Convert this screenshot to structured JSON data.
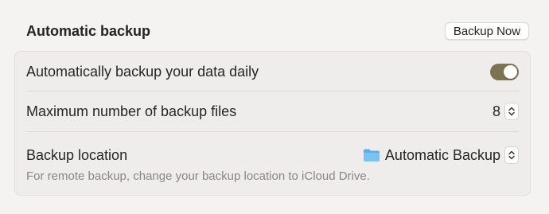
{
  "section": {
    "title": "Automatic backup",
    "backup_now_label": "Backup Now"
  },
  "settings": {
    "daily_backup": {
      "label": "Automatically backup your data daily",
      "enabled": true,
      "toggle_color": "#7e7255"
    },
    "max_files": {
      "label": "Maximum number of backup files",
      "value": "8"
    },
    "location": {
      "label": "Backup location",
      "value": "Automatic Backup",
      "icon": "folder-icon",
      "hint": "For remote backup, change your backup location to iCloud Drive."
    }
  }
}
